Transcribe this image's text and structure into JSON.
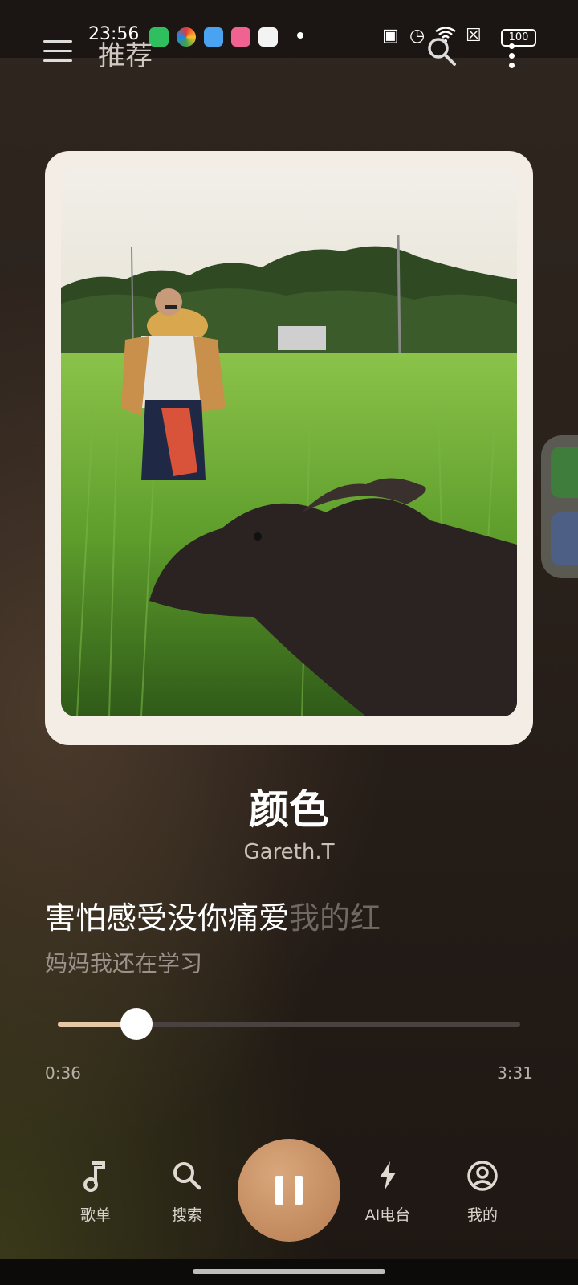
{
  "status_bar": {
    "time": "23:56",
    "battery": "100",
    "app_icons": [
      "shield-app-icon",
      "pinwheel-app-icon",
      "weather-app-icon",
      "bilibili-app-icon",
      "photos-app-icon"
    ],
    "system_icons": [
      "nfc-icon",
      "alarm-icon",
      "wifi-icon",
      "sim-off-icon",
      "battery-icon"
    ]
  },
  "header": {
    "tab_title": "推荐",
    "menu_icon": "menu-icon",
    "search_icon": "search-icon",
    "more_icon": "more-vertical-icon"
  },
  "now_playing": {
    "title": "颜色",
    "artist": "Gareth.T",
    "lyric_current_sung": "害怕感受没你痛爱",
    "lyric_current_unsung": "我的红",
    "lyric_next": "妈妈我还在学习",
    "progress": 0.17,
    "time_current": "0:36",
    "time_total": "3:31",
    "state": "playing"
  },
  "nav": {
    "items": [
      {
        "label": "歌单",
        "icon": "music-note-icon"
      },
      {
        "label": "搜索",
        "icon": "search-icon"
      },
      {
        "label": "AI电台",
        "icon": "lightning-icon"
      },
      {
        "label": "我的",
        "icon": "profile-icon"
      }
    ],
    "play_button_icon": "pause-icon"
  },
  "colors": {
    "accent": "#c79269",
    "progress_fill": "#e5c8a6",
    "card": "#f3ede6"
  }
}
